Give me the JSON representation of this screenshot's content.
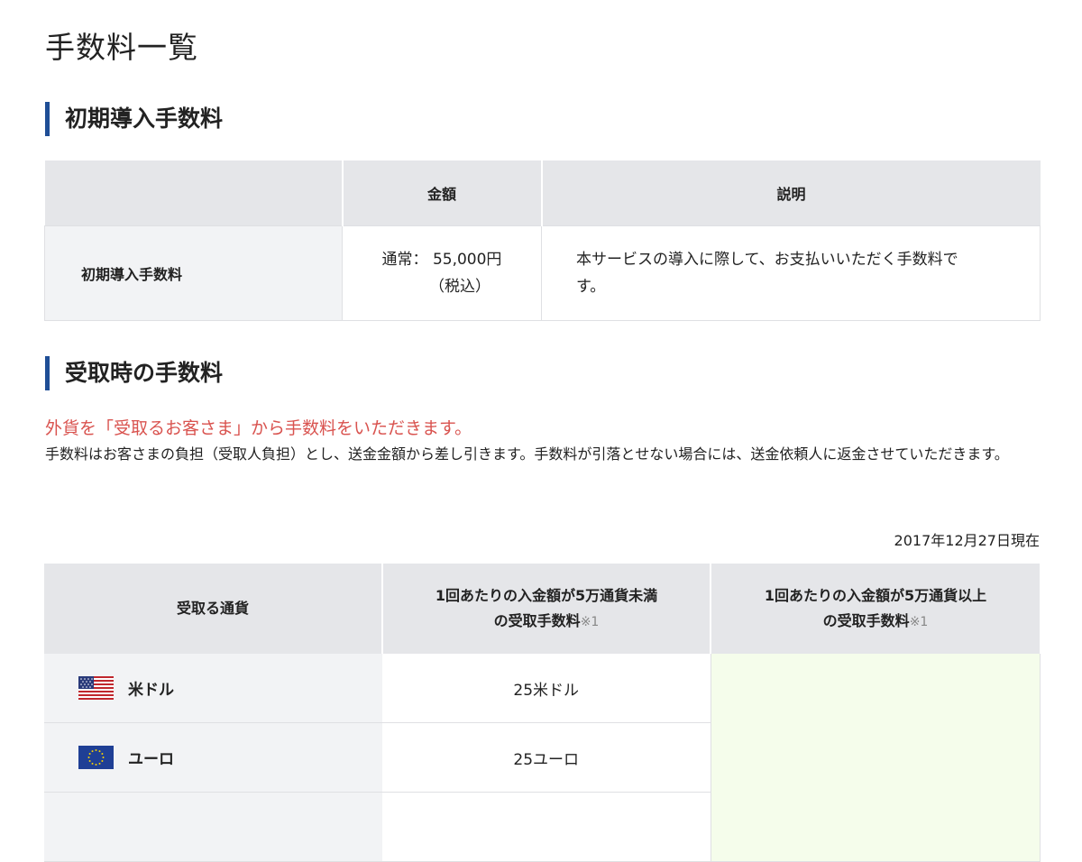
{
  "page_title": "手数料一覧",
  "initial_section": {
    "title": "初期導入手数料",
    "headers": [
      "",
      "金額",
      "説明"
    ],
    "row": {
      "label": "初期導入手数料",
      "amount_line1": "通常： 55,000円",
      "amount_line2": "（税込）",
      "description": "本サービスの導入に際して、お支払いいただく手数料です。"
    }
  },
  "receive_section": {
    "title": "受取時の手数料",
    "notice_red": "外貨を「受取るお客さま」から手数料をいただきます。",
    "notice_body": "手数料はお客さまの負担（受取人負担）とし、送金金額から差し引きます。手数料が引落とせない場合には、送金依頼人に返金させていただきます。",
    "as_of": "2017年12月27日現在",
    "headers": {
      "currency": "受取る通貨",
      "under_line1": "1回あたりの入金額が5万通貨未満",
      "under_line2": "の受取手数料",
      "over_line1": "1回あたりの入金額が5万通貨以上",
      "over_line2": "の受取手数料",
      "note": "※1"
    },
    "rows": [
      {
        "currency": "米ドル",
        "flag_icon": "us-flag-icon",
        "fee": "25米ドル"
      },
      {
        "currency": "ユーロ",
        "flag_icon": "eu-flag-icon",
        "fee": "25ユーロ"
      }
    ],
    "colors": {
      "accent_bar": "#1f4e96",
      "notice_red": "#d9534f",
      "over_fee_bg": "#f5fdeb"
    }
  }
}
